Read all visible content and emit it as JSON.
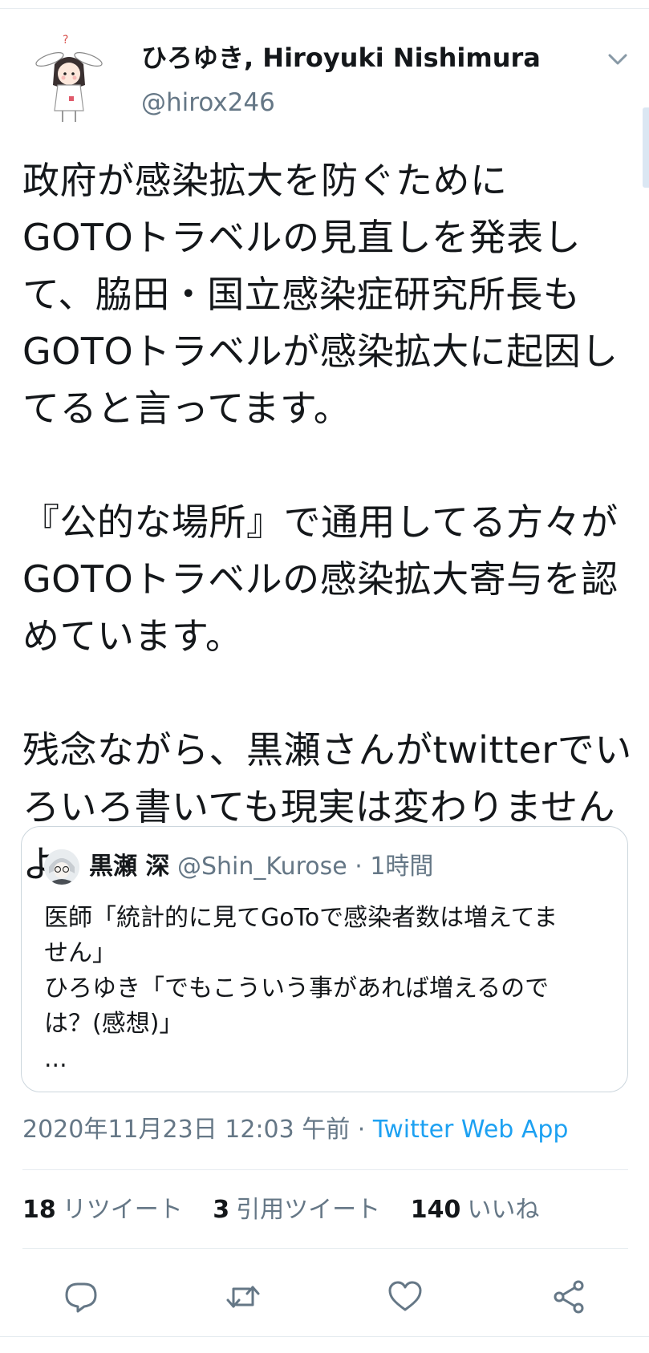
{
  "tweet": {
    "display_name": "ひろゆき, Hiroyuki Nishimura",
    "handle": "@hirox246",
    "text": "政府が感染拡大を防ぐために\nGOTOトラベルの見直しを発表し\nて、脇田・国立感染症研究所長も\nGOTOトラベルが感染拡大に起因し\nてると言ってます。\n\n『公的な場所』で通用してる方々が\nGOTOトラベルの感染拡大寄与を認\nめています。\n\n残念ながら、黒瀬さんがtwitterでい\nろいろ書いても現実は変わりません\nよ。",
    "date": "2020年11月23日 12:03 午前",
    "separator": " · ",
    "source": "Twitter Web App"
  },
  "quoted": {
    "name": "黒瀬 深",
    "handle": "@Shin_Kurose",
    "separator": " · ",
    "time": "1時間",
    "text": "医師「統計的に見てGoToで感染者数は増えてま\nせん」\nひろゆき「でもこういう事があれば増えるので\nは？(感想)」\n..."
  },
  "stats": {
    "retweets_count": "18",
    "retweets_label": "リツイート",
    "quotes_count": "3",
    "quotes_label": "引用ツイート",
    "likes_count": "140",
    "likes_label": "いいね"
  },
  "icons": {
    "reply": "reply-icon",
    "retweet": "retweet-icon",
    "like": "heart-icon",
    "share": "share-icon",
    "menu": "chevron-down-icon"
  },
  "colors": {
    "text": "#14171a",
    "secondary": "#657786",
    "link": "#1da1f2",
    "border": "#e6ecf0"
  }
}
